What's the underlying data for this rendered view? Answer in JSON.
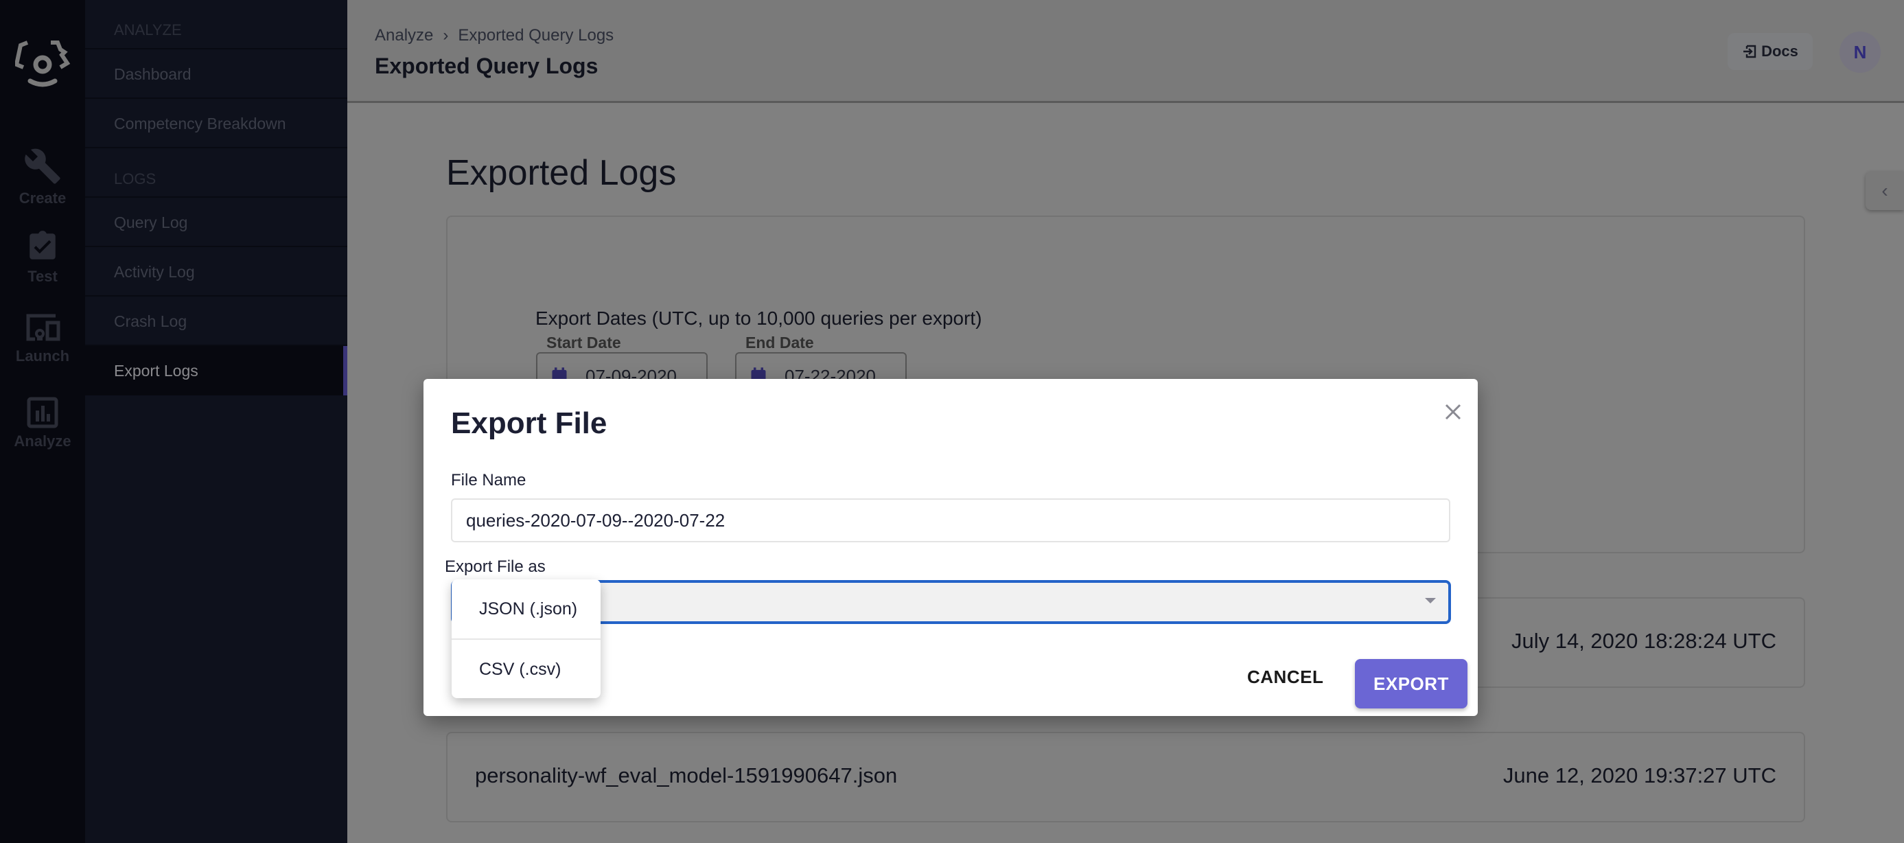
{
  "rail": {
    "items": [
      {
        "label": "Create",
        "icon": "wrench-icon"
      },
      {
        "label": "Test",
        "icon": "clipboard-check-icon"
      },
      {
        "label": "Launch",
        "icon": "devices-icon"
      },
      {
        "label": "Analyze",
        "icon": "bar-chart-icon"
      }
    ]
  },
  "sidebar": {
    "sections": [
      {
        "title": "ANALYZE",
        "items": [
          "Dashboard",
          "Competency Breakdown"
        ]
      },
      {
        "title": "LOGS",
        "items": [
          "Query Log",
          "Activity Log",
          "Crash Log",
          "Export Logs"
        ]
      }
    ],
    "active_item": "Export Logs",
    "accent_color": "#6b66d4"
  },
  "header": {
    "breadcrumb": [
      "Analyze",
      "Exported Query Logs"
    ],
    "title": "Exported Query Logs",
    "docs_label": "Docs",
    "avatar_initial": "N"
  },
  "main": {
    "title": "Exported Logs",
    "export_dates_label": "Export Dates (UTC, up to 10,000 queries per export)",
    "start_date_label": "Start Date",
    "start_date": "07-09-2020",
    "end_date_label": "End Date",
    "end_date": "07-22-2020",
    "logs": [
      {
        "filename": "",
        "date": "July 14, 2020 18:28:24 UTC"
      },
      {
        "filename": "personality-wf_eval_model-1591990647.json",
        "date": "June 12, 2020 19:37:27 UTC"
      }
    ]
  },
  "modal": {
    "title": "Export File",
    "file_name_label": "File Name",
    "file_name_value": "queries-2020-07-09--2020-07-22",
    "format_label": "Export File as",
    "format_options": [
      "JSON (.json)",
      "CSV (.csv)"
    ],
    "cancel_label": "CANCEL",
    "export_label": "EXPORT",
    "focus_color": "#2463c8",
    "primary_color": "#6b66d4"
  }
}
